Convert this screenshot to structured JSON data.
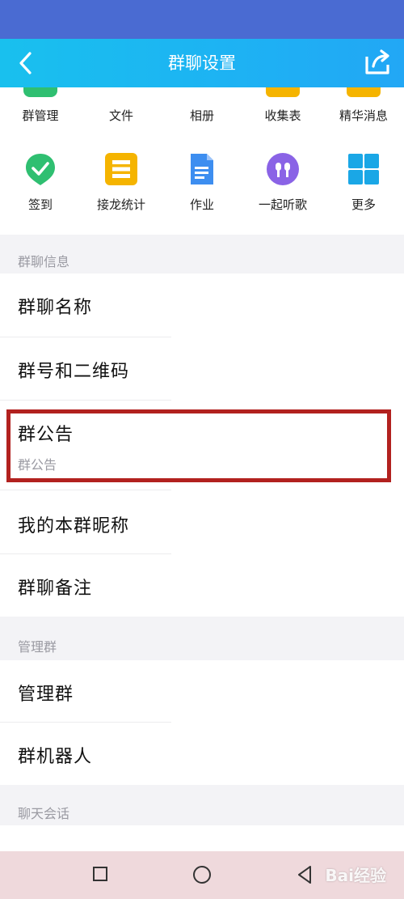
{
  "header": {
    "title": "群聊设置"
  },
  "grid": {
    "row1": [
      "群管理",
      "文件",
      "相册",
      "收集表",
      "精华消息"
    ],
    "row2": [
      {
        "label": "签到",
        "icon": "checkin-icon"
      },
      {
        "label": "接龙统计",
        "icon": "chain-stats-icon"
      },
      {
        "label": "作业",
        "icon": "homework-icon"
      },
      {
        "label": "一起听歌",
        "icon": "listen-together-icon"
      },
      {
        "label": "更多",
        "icon": "more-grid-icon"
      }
    ]
  },
  "sections": {
    "group_info": {
      "header": "群聊信息",
      "items": {
        "name": "群聊名称",
        "number_qr": "群号和二维码",
        "announcement": "群公告",
        "announcement_sub": "群公告",
        "nickname": "我的本群昵称",
        "remark": "群聊备注"
      }
    },
    "manage": {
      "header": "管理群",
      "items": {
        "manage": "管理群",
        "robot": "群机器人"
      }
    },
    "chat": {
      "header": "聊天会话"
    }
  },
  "watermark": "Bai经验",
  "colors": {
    "accent": "#1db3f3",
    "status_bar": "#4a6bd2",
    "highlight": "#b2211f",
    "checkin": "#2fbf71",
    "chain": "#f5b400",
    "homework": "#3d8ef0",
    "listen": "#8a63e6",
    "more": "#1aa7e6"
  }
}
